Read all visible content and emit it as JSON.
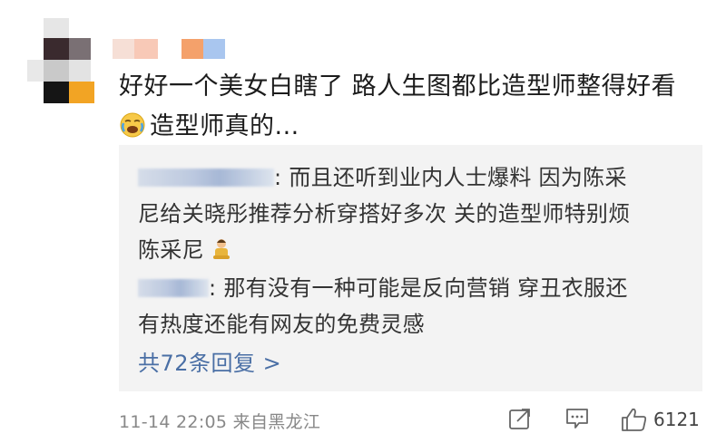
{
  "comment": {
    "line1": "好好一个美女白瞎了 路人生图都比造型师整得好看",
    "line2_text": "造型师真的...",
    "emoji_icon": "crying-face-icon"
  },
  "replies": [
    {
      "sep": ": ",
      "text_line1": "而且还听到业内人士爆料 因为陈采",
      "text_line2": "尼给关晓彤推荐分析穿搭好多次 关的造型师特别烦",
      "text_line3": "陈采尼",
      "emoji_icon": "person-shrug-icon"
    },
    {
      "sep": ": ",
      "text_line1": "那有没有一种可能是反向营销 穿丑衣服还",
      "text_line2": "有热度还能有网友的免费灵感"
    }
  ],
  "more_replies": "共72条回复 >",
  "meta": {
    "date": "11-14 22:05",
    "location": "来自黑龙江"
  },
  "actions": {
    "like_count": "6121"
  },
  "colors": {
    "link": "#4a6fa5",
    "reply_bg": "#f3f3f3"
  }
}
